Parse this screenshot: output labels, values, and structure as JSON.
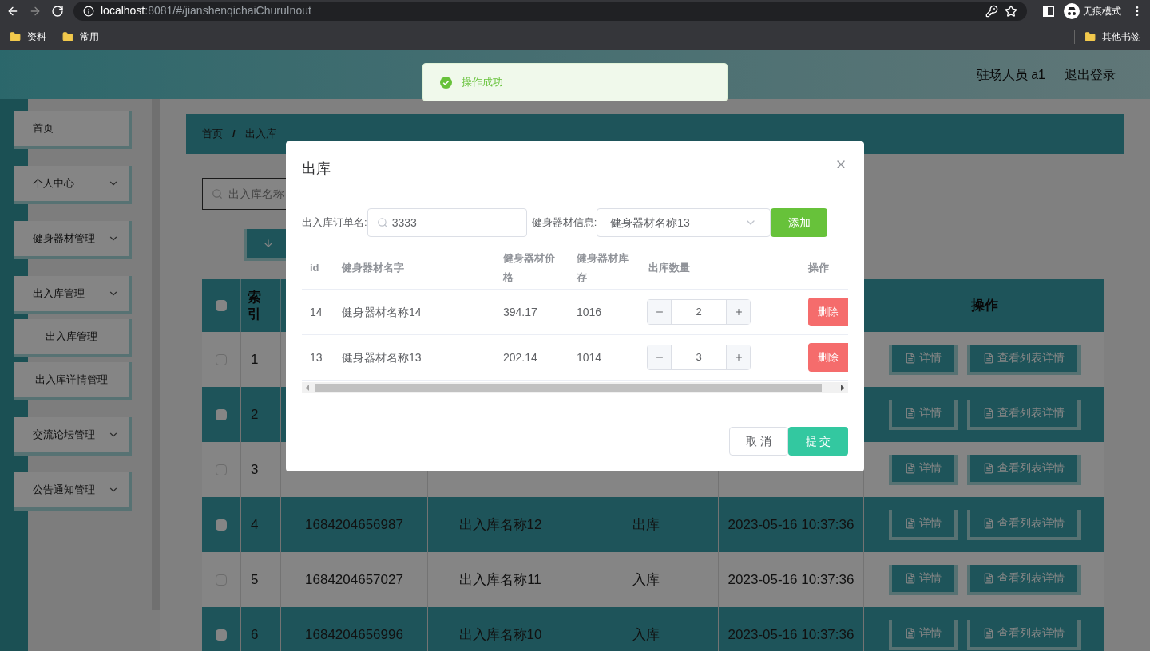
{
  "browser": {
    "host": "localhost",
    "path": ":8081/#/jianshenqichaiChuruInout",
    "incognito_label": "无痕模式",
    "bookmarks": [
      "资料",
      "常用"
    ],
    "other_bookmarks": "其他书签"
  },
  "header": {
    "user": "驻场人员 a1",
    "logout": "退出登录"
  },
  "toast": {
    "kind": "success",
    "message": "操作成功"
  },
  "sidebar": {
    "items": [
      {
        "label": "首页",
        "kind": "link"
      },
      {
        "label": "个人中心",
        "kind": "submenu"
      },
      {
        "label": "健身器材管理",
        "kind": "submenu"
      },
      {
        "label": "出入库管理",
        "kind": "submenu",
        "children": [
          {
            "label": "出入库管理"
          },
          {
            "label": "出入库详情管理"
          }
        ]
      },
      {
        "label": "交流论坛管理",
        "kind": "submenu"
      },
      {
        "label": "公告通知管理",
        "kind": "submenu"
      }
    ]
  },
  "breadcrumb": [
    "首页",
    "/",
    "出入库"
  ],
  "search": {
    "placeholder": "出入库名称"
  },
  "table": {
    "select_all": {
      "checked": false
    },
    "columns": [
      "索引",
      "操作"
    ],
    "rows": [
      {
        "checked": false,
        "index": "1",
        "actions": [
          "详情",
          "查看列表详情"
        ]
      },
      {
        "checked": false,
        "index": "2",
        "actions": [
          "详情",
          "查看列表详情"
        ]
      },
      {
        "checked": false,
        "index": "3",
        "actions": [
          "详情",
          "查看列表详情"
        ]
      },
      {
        "checked": false,
        "index": "4",
        "cells": [
          "1684204656987",
          "出入库名称12",
          "出库",
          "2023-05-16 10:37:36"
        ],
        "actions": [
          "详情",
          "查看列表详情"
        ]
      },
      {
        "checked": false,
        "index": "5",
        "cells": [
          "1684204657027",
          "出入库名称11",
          "入库",
          "2023-05-16 10:37:36"
        ],
        "actions": [
          "详情",
          "查看列表详情"
        ]
      },
      {
        "checked": false,
        "index": "6",
        "cells": [
          "1684204656996",
          "出入库名称10",
          "入库",
          "2023-05-16 10:37:36"
        ],
        "actions": [
          "详情",
          "查看列表详情"
        ]
      }
    ]
  },
  "dialog": {
    "title": "出库",
    "order_label": "出入库订单名:",
    "order_value": "3333",
    "equipment_label": "健身器材信息:",
    "equipment_value": "健身器材名称13",
    "add_button": "添加",
    "columns": [
      "id",
      "健身器材名字",
      "健身器材价格",
      "健身器材库存",
      "出库数量",
      "操作"
    ],
    "rows": [
      {
        "id": "14",
        "name": "健身器材名称14",
        "price": "394.17",
        "stock": "1016",
        "quantity": "2",
        "action": "删除"
      },
      {
        "id": "13",
        "name": "健身器材名称13",
        "price": "202.14",
        "stock": "1014",
        "quantity": "3",
        "action": "删除"
      }
    ],
    "cancel": "取 消",
    "submit": "提 交"
  }
}
